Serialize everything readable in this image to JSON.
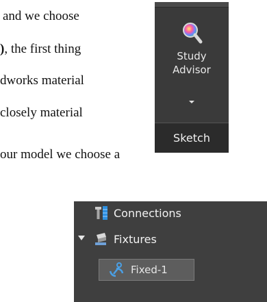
{
  "document": {
    "lines": [
      {
        "text": "and we choose"
      },
      {
        "pre": ")",
        "text": ", the first thing"
      },
      {
        "text": "dworks material"
      },
      {
        "text": "closely material"
      },
      {
        "text": "our model we choose a"
      }
    ]
  },
  "ribbon": {
    "button_line1": "Study",
    "button_line2": "Advisor",
    "tab_label": "Sketch",
    "icon": "study-advisor-icon",
    "colors": {
      "background": "#3a3a3a",
      "tab": "#2b2b2b",
      "text": "#e8e8e8"
    }
  },
  "tree": {
    "items": [
      {
        "label": "Connections",
        "icon": "connections-icon"
      },
      {
        "label": "Fixtures",
        "icon": "fixtures-icon",
        "expanded": true
      },
      {
        "label": "Fixed-1",
        "icon": "fixed-anchor-icon",
        "selected": true
      }
    ],
    "colors": {
      "background": "#3f3f3f",
      "selected": "#5d5d5d",
      "text": "#f2f2f2"
    }
  }
}
